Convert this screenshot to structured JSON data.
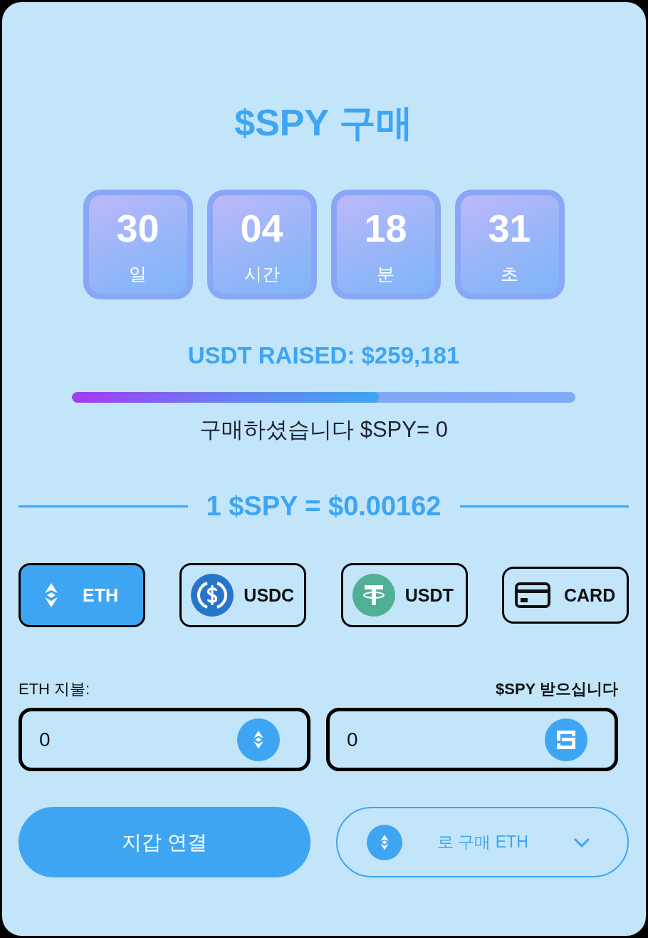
{
  "title": "$SPY 구매",
  "countdown": [
    {
      "value": "30",
      "unit": "일"
    },
    {
      "value": "04",
      "unit": "시간"
    },
    {
      "value": "18",
      "unit": "분"
    },
    {
      "value": "31",
      "unit": "초"
    }
  ],
  "raised": {
    "text": "USDT RAISED: $259,181",
    "level": 0.61
  },
  "purchased": "구매하셨습니다 $SPY= 0",
  "price": "1 $SPY = $0.00162",
  "payment_methods": [
    {
      "kind": "eth",
      "label": "ETH",
      "selected": true
    },
    {
      "kind": "usdc",
      "label": "USDC",
      "selected": false
    },
    {
      "kind": "usdt",
      "label": "USDT",
      "selected": false
    },
    {
      "kind": "card",
      "label": "CARD",
      "selected": false
    }
  ],
  "fields": [
    {
      "kind": "eth",
      "label": "ETH 지불:",
      "value": "0"
    },
    {
      "kind": "spy",
      "label": "$SPY 받으십니다",
      "value": "0"
    }
  ],
  "connect_button": "지갑 연결",
  "buy_with": {
    "label": "로 구매 ETH"
  }
}
